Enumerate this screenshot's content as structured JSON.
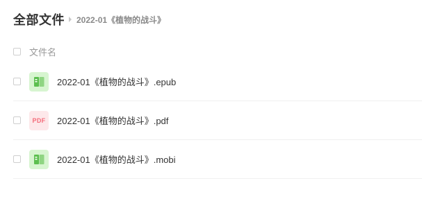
{
  "breadcrumb": {
    "root": "全部文件",
    "current": "2022-01《植物的战斗》"
  },
  "list_header": {
    "column_name": "文件名"
  },
  "files": [
    {
      "name": "2022-01《植物的战斗》.epub",
      "icon": "ebook-icon"
    },
    {
      "name": "2022-01《植物的战斗》.pdf",
      "icon": "pdf-icon",
      "icon_text": "PDF"
    },
    {
      "name": "2022-01《植物的战斗》.mobi",
      "icon": "ebook-icon"
    }
  ],
  "colors": {
    "ebook_icon_bg": "#d7f5d0",
    "ebook_icon_fg": "#5cbf4f",
    "pdf_icon_bg": "#fde8ea",
    "pdf_icon_fg": "#f46c7a"
  }
}
